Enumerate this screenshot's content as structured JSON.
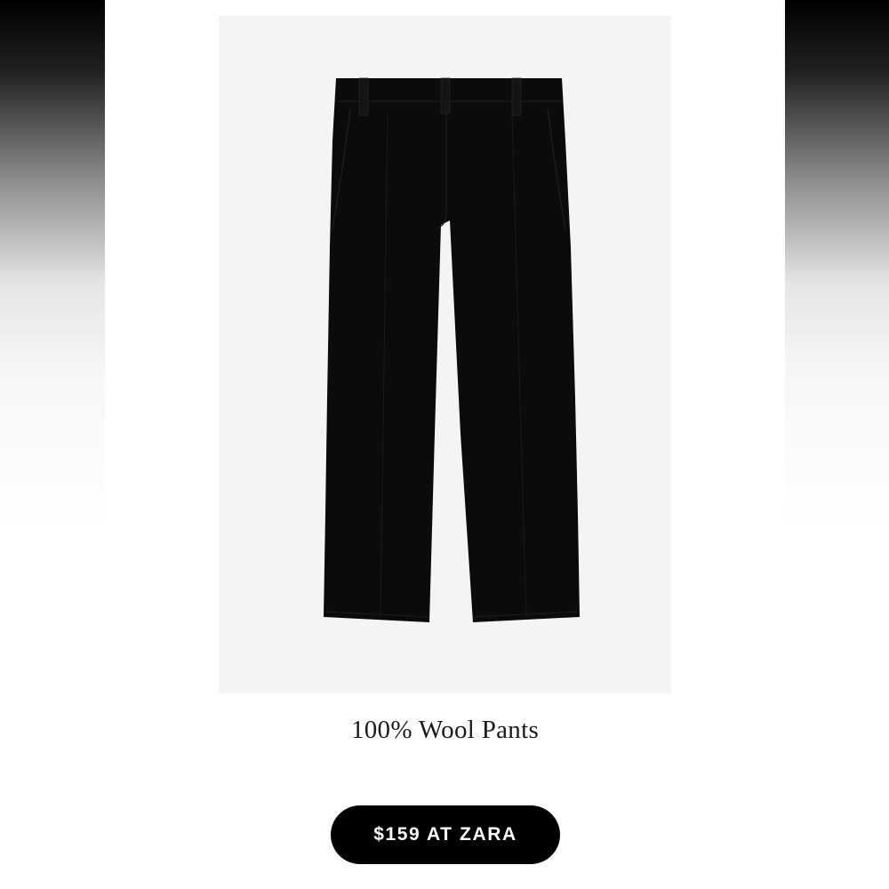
{
  "product": {
    "title": "100% Wool Pants",
    "image_icon": "black-wool-trousers-image",
    "image_background": "#f4f4f4",
    "garment_color": "#0b0b0b"
  },
  "cta": {
    "label": "$159 AT ZARA",
    "background": "#000000",
    "text_color": "#ffffff"
  }
}
